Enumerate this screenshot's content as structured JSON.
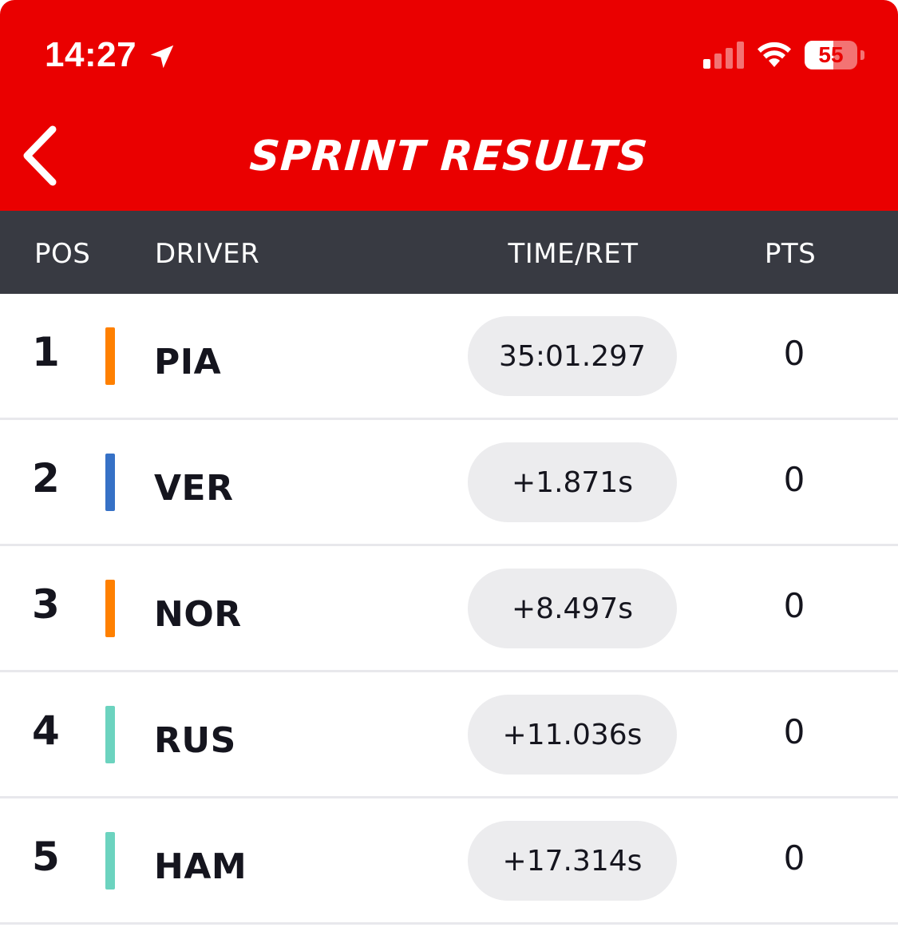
{
  "status_bar": {
    "time": "14:27",
    "battery": "55",
    "battery_level": 0.55
  },
  "nav": {
    "title": "SPRINT RESULTS"
  },
  "columns": {
    "pos": "POS",
    "driver": "DRIVER",
    "time": "TIME/RET",
    "pts": "PTS"
  },
  "rows": [
    {
      "pos": "1",
      "driver": "PIA",
      "time": "35:01.297",
      "pts": "0",
      "team_color": "#ff8000"
    },
    {
      "pos": "2",
      "driver": "VER",
      "time": "+1.871s",
      "pts": "0",
      "team_color": "#3671c6"
    },
    {
      "pos": "3",
      "driver": "NOR",
      "time": "+8.497s",
      "pts": "0",
      "team_color": "#ff8000"
    },
    {
      "pos": "4",
      "driver": "RUS",
      "time": "+11.036s",
      "pts": "0",
      "team_color": "#6cd3bf"
    },
    {
      "pos": "5",
      "driver": "HAM",
      "time": "+17.314s",
      "pts": "0",
      "team_color": "#6cd3bf"
    }
  ],
  "colors": {
    "header_red": "#ea0000",
    "column_bar": "#383a42",
    "time_pill": "#ececee",
    "text_dark": "#15151e"
  },
  "icons": {
    "back": "chevron-left-icon",
    "location": "location-arrow-icon",
    "signal": "cellular-signal-icon",
    "wifi": "wifi-icon",
    "battery": "battery-icon"
  }
}
